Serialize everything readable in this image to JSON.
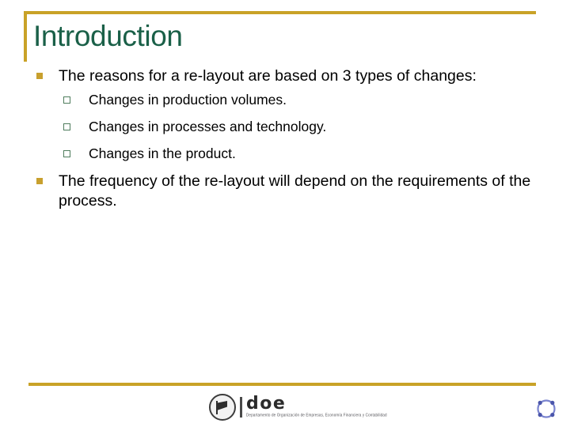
{
  "slide": {
    "title": "Introduction",
    "accent_gold": "#c9a227",
    "title_color": "#1a6048",
    "bullet_marker_color": "#c8a02e",
    "subbullet_marker_color": "#4f7d5d",
    "background": "#ffffff"
  },
  "content": {
    "bullets": [
      {
        "level": 1,
        "text": "The reasons for a re-layout are based on 3 types of changes:"
      },
      {
        "level": 2,
        "text": "Changes in production volumes."
      },
      {
        "level": 2,
        "text": "Changes in processes and technology."
      },
      {
        "level": 2,
        "text": "Changes in the product."
      },
      {
        "level": 1,
        "text": "The frequency of the re-layout will depend on the requirements of the process."
      }
    ]
  },
  "footer": {
    "logo_wordmark": "doe",
    "logo_subtitle": "Departamento de Organización de Empresas, Economía Financiera y Contabilidad",
    "corner_emblem_color": "#6b74c4"
  }
}
